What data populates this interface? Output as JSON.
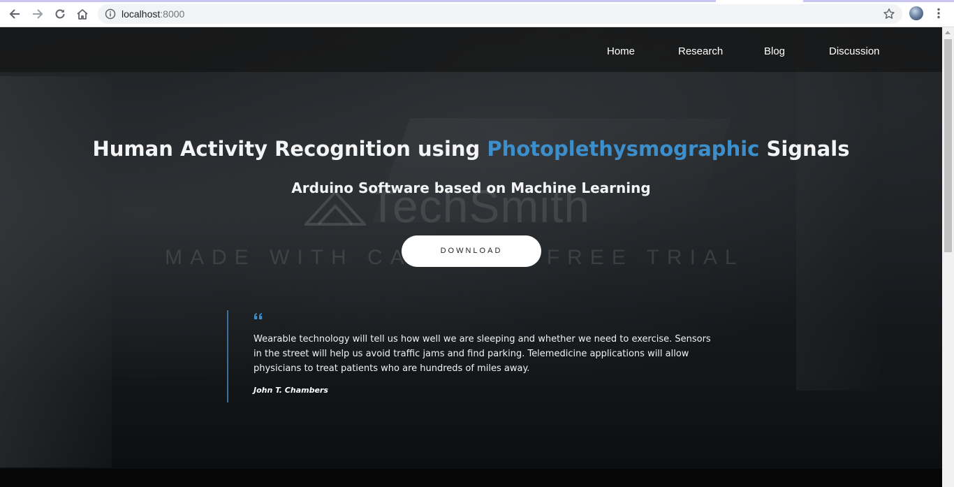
{
  "browser": {
    "url_host": "localhost",
    "url_port": ":8000",
    "icons": [
      "back-arrow-icon",
      "forward-arrow-icon",
      "reload-icon",
      "home-icon",
      "site-info-icon",
      "bookmark-star-icon",
      "profile-avatar",
      "more-menu-icon"
    ]
  },
  "nav": {
    "items": [
      {
        "label": "Home"
      },
      {
        "label": "Research"
      },
      {
        "label": "Blog"
      },
      {
        "label": "Discussion"
      }
    ]
  },
  "hero": {
    "title_prefix": "Human Activity Recognition using ",
    "title_accent": "Photoplethysmographic",
    "title_suffix": " Signals",
    "subtitle": "Arduino Software based on Machine Learning",
    "download_label": "DOWNLOAD",
    "accent_color": "#3d8fcb"
  },
  "watermark": {
    "logo_text": "TechSmith",
    "trial_text": "MADE WITH CAMTASIA FREE TRIAL"
  },
  "quote": {
    "text": "Wearable technology will tell us how well we are sleeping and whether we need to exercise. Sensors in the street will help us avoid traffic jams and find parking. Telemedicine applications will allow physicians to treat patients who are hundreds of miles away.",
    "author": "John T. Chambers"
  }
}
